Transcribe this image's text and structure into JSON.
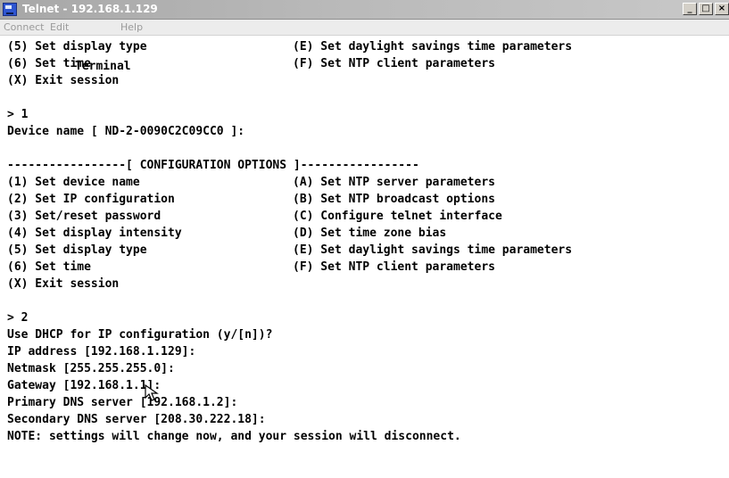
{
  "window": {
    "title": "Telnet - 192.168.1.129"
  },
  "menubar": {
    "items": [
      "Connect",
      "Edit",
      "Terminal",
      "Help"
    ]
  },
  "terminal": {
    "lines": [
      {
        "left": "(5) Set display type",
        "right": "(E) Set daylight savings time parameters"
      },
      {
        "left": "(6) Set time",
        "right": "(F) Set NTP client parameters"
      },
      {
        "left": "(X) Exit session",
        "right": ""
      },
      {
        "left": "",
        "right": ""
      },
      {
        "left": "> 1",
        "right": ""
      },
      {
        "left": "Device name [ ND-2-0090C2C09CC0 ]:",
        "right": ""
      },
      {
        "left": "",
        "right": ""
      },
      {
        "left": "-----------------[ CONFIGURATION OPTIONS ]-----------------",
        "right": ""
      },
      {
        "left": "(1) Set device name",
        "right": "(A) Set NTP server parameters"
      },
      {
        "left": "(2) Set IP configuration",
        "right": "(B) Set NTP broadcast options"
      },
      {
        "left": "(3) Set/reset password",
        "right": "(C) Configure telnet interface"
      },
      {
        "left": "(4) Set display intensity",
        "right": "(D) Set time zone bias"
      },
      {
        "left": "(5) Set display type",
        "right": "(E) Set daylight savings time parameters"
      },
      {
        "left": "(6) Set time",
        "right": "(F) Set NTP client parameters"
      },
      {
        "left": "(X) Exit session",
        "right": ""
      },
      {
        "left": "",
        "right": ""
      },
      {
        "left": "> 2",
        "right": ""
      },
      {
        "left": "Use DHCP for IP configuration (y/[n])?",
        "right": ""
      },
      {
        "left": "IP address [192.168.1.129]:",
        "right": ""
      },
      {
        "left": "Netmask [255.255.255.0]:",
        "right": ""
      },
      {
        "left": "Gateway [192.168.1.1]:",
        "right": ""
      },
      {
        "left": "Primary DNS server [192.168.1.2]:",
        "right": ""
      },
      {
        "left": "Secondary DNS server [208.30.222.18]:",
        "right": ""
      },
      {
        "left": "NOTE: settings will change now, and your session will disconnect.",
        "right": ""
      }
    ]
  },
  "colors": {
    "title_bar": "#b9b9b9",
    "menu_text": "#9a9a9a",
    "terminal_bg": "#ffffff",
    "terminal_text": "#000000"
  },
  "icons": {
    "app": "telnet-app-icon",
    "minimize": "minimize-icon",
    "maximize": "maximize-icon",
    "close": "close-icon",
    "cursor": "mouse-pointer-icon"
  }
}
